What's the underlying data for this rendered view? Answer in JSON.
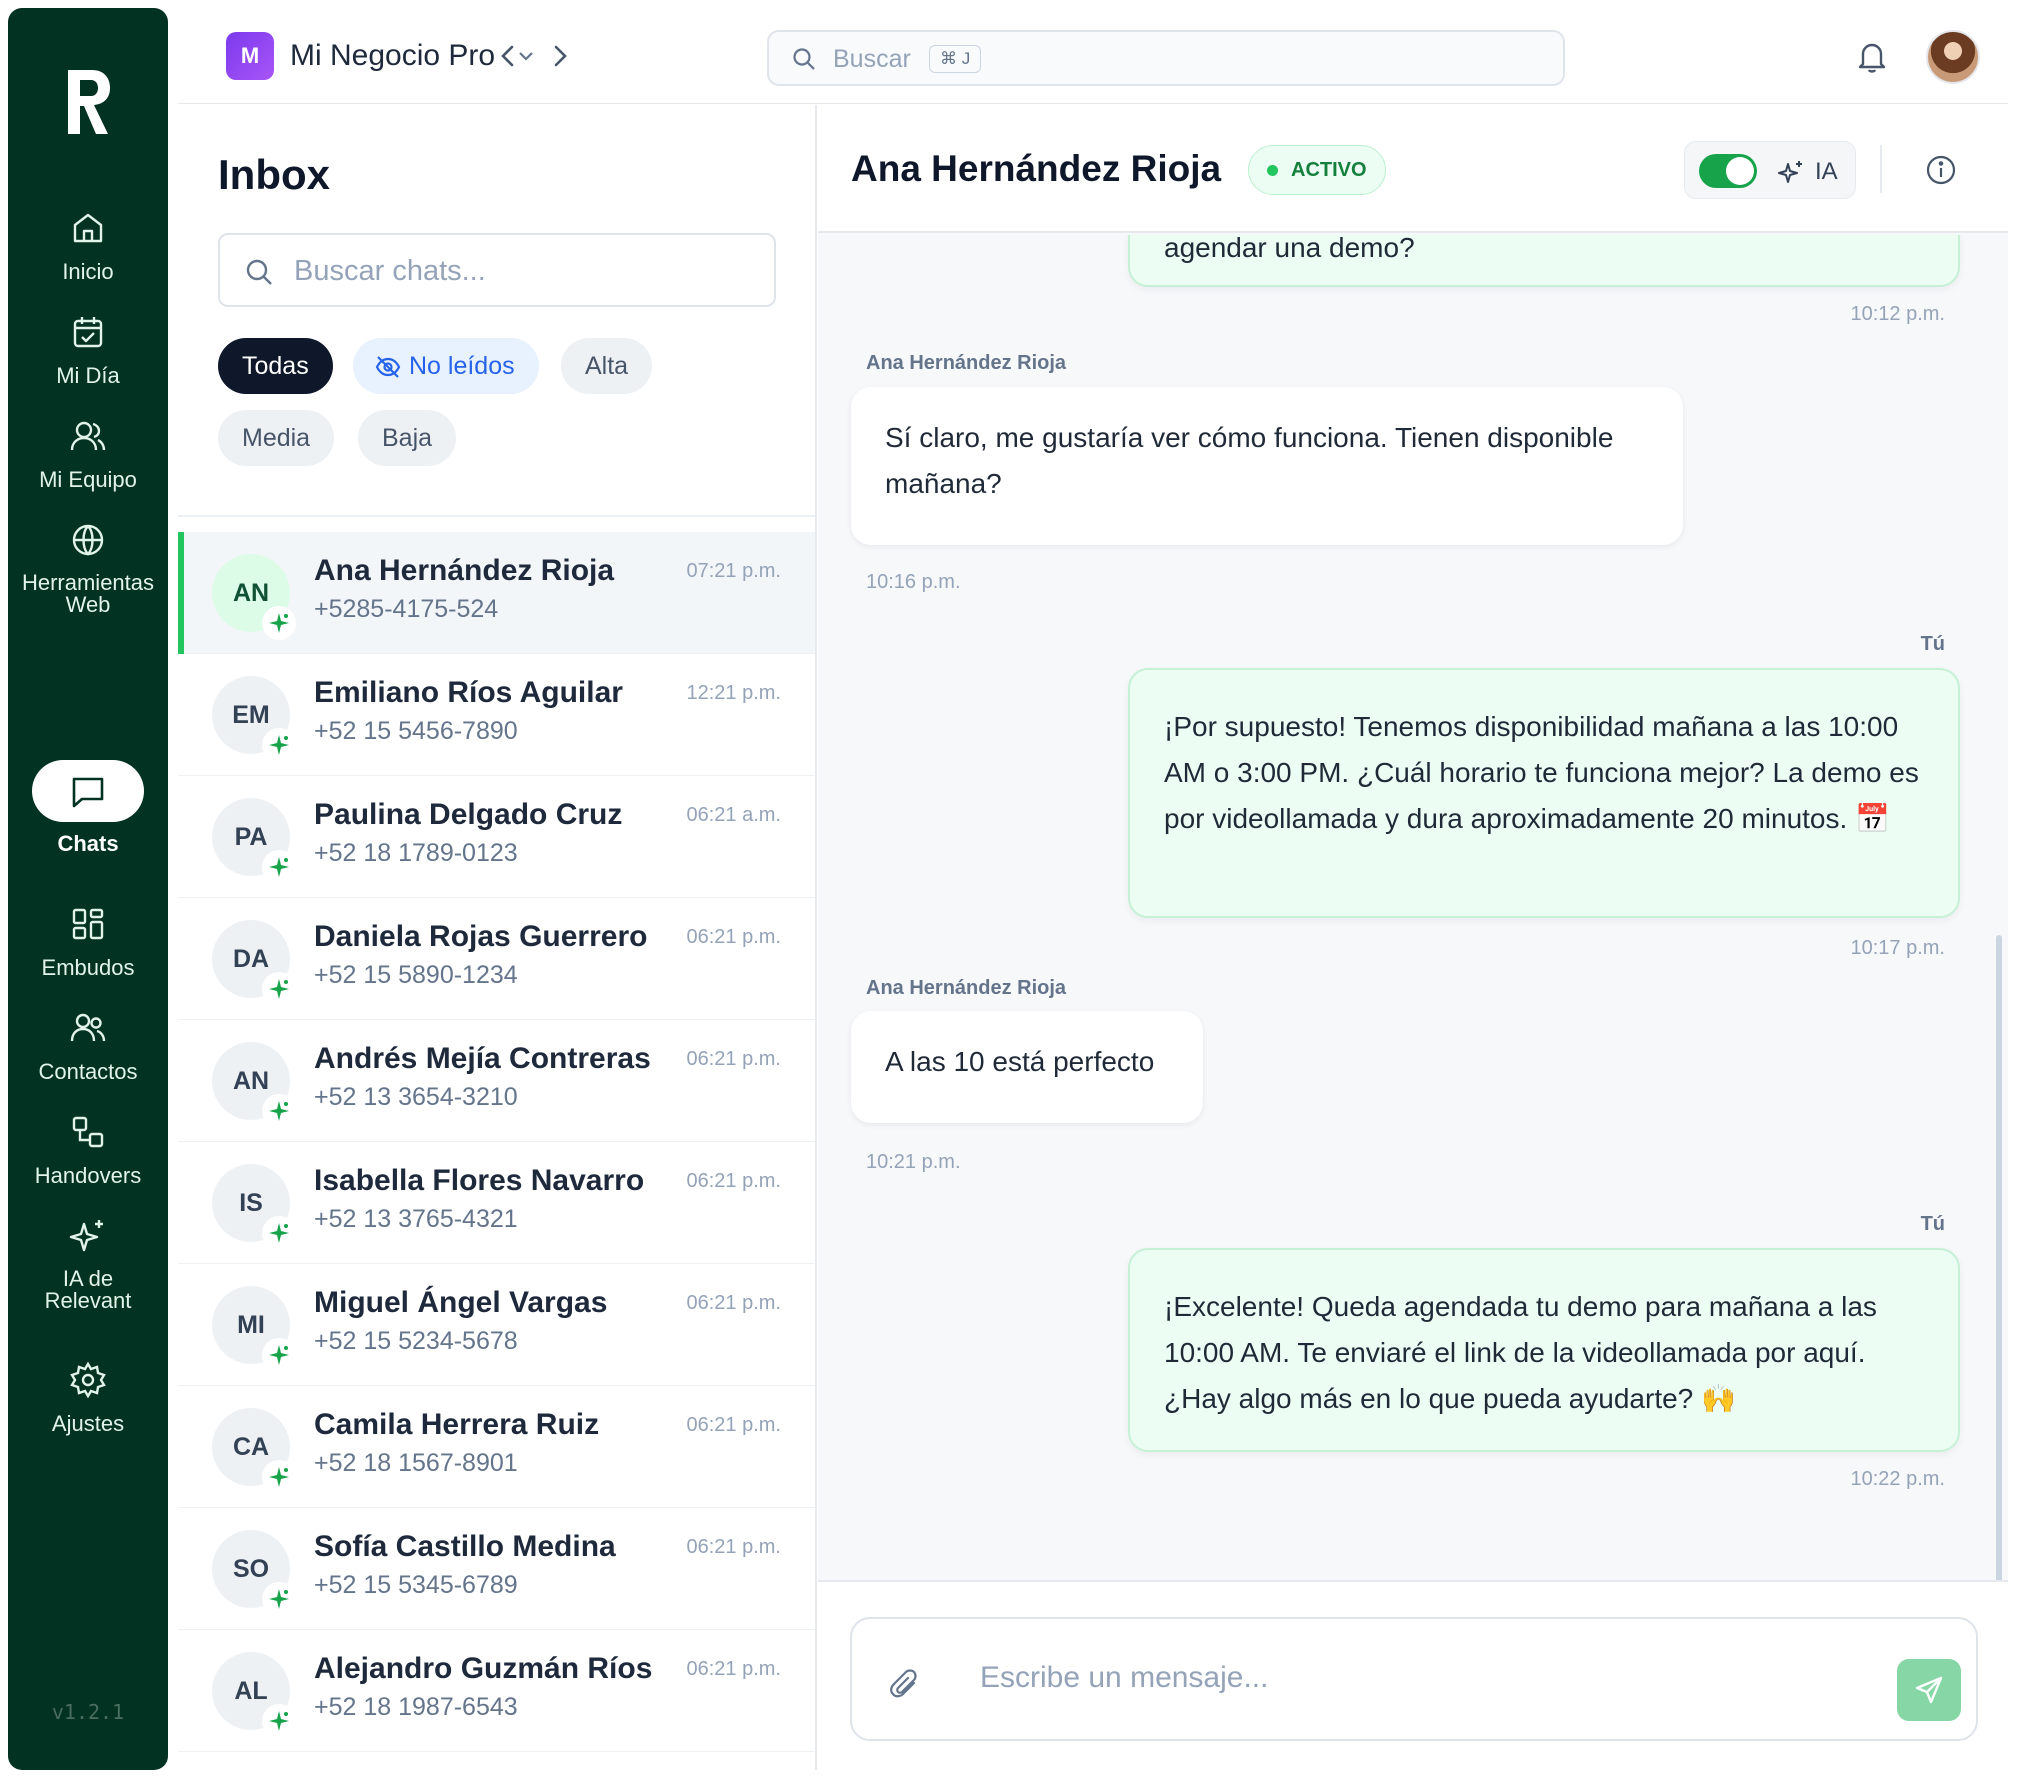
{
  "sidebar": {
    "items": [
      {
        "label": "Inicio",
        "icon": "home-icon"
      },
      {
        "label": "Mi Día",
        "icon": "calendar-check-icon"
      },
      {
        "label": "Mi Equipo",
        "icon": "users-icon"
      },
      {
        "label": "Herramientas Web",
        "icon": "globe-icon"
      },
      {
        "label": "Chats",
        "icon": "chat-icon",
        "active": true
      },
      {
        "label": "Embudos",
        "icon": "grid-icon"
      },
      {
        "label": "Contactos",
        "icon": "contacts-icon"
      },
      {
        "label": "Handovers",
        "icon": "handover-icon"
      },
      {
        "label": "IA de Relevant",
        "icon": "sparkles-icon"
      },
      {
        "label": "Ajustes",
        "icon": "gear-icon"
      }
    ],
    "version": "v1.2.1"
  },
  "topbar": {
    "workspace_initial": "M",
    "workspace_name": "Mi Negocio Pro",
    "search_placeholder": "Buscar",
    "search_shortcut": "⌘ J"
  },
  "inbox": {
    "title": "Inbox",
    "search_placeholder": "Buscar chats...",
    "filters": [
      "Todas",
      "No leídos",
      "Alta",
      "Media",
      "Baja"
    ],
    "chats": [
      {
        "initials": "AN",
        "name": "Ana Hernández Rioja",
        "phone": "+5285-4175-524",
        "time": "07:21 p.m.",
        "active": true
      },
      {
        "initials": "EM",
        "name": "Emiliano Ríos Aguilar",
        "phone": "+52 15 5456-7890",
        "time": "12:21 p.m."
      },
      {
        "initials": "PA",
        "name": "Paulina Delgado Cruz",
        "phone": "+52 18 1789-0123",
        "time": "06:21 a.m."
      },
      {
        "initials": "DA",
        "name": "Daniela Rojas Guerrero",
        "phone": "+52 15 5890-1234",
        "time": "06:21 p.m."
      },
      {
        "initials": "AN",
        "name": "Andrés Mejía Contreras",
        "phone": "+52 13 3654-3210",
        "time": "06:21 p.m."
      },
      {
        "initials": "IS",
        "name": "Isabella Flores Navarro",
        "phone": "+52 13 3765-4321",
        "time": "06:21 p.m."
      },
      {
        "initials": "MI",
        "name": "Miguel Ángel Vargas",
        "phone": "+52 15 5234-5678",
        "time": "06:21 p.m."
      },
      {
        "initials": "CA",
        "name": "Camila Herrera Ruiz",
        "phone": "+52 18 1567-8901",
        "time": "06:21 p.m."
      },
      {
        "initials": "SO",
        "name": "Sofía Castillo Medina",
        "phone": "+52 15 5345-6789",
        "time": "06:21 p.m."
      },
      {
        "initials": "AL",
        "name": "Alejandro Guzmán Ríos",
        "phone": "+52 18 1987-6543",
        "time": "06:21 p.m."
      }
    ]
  },
  "conversation": {
    "contact_name": "Ana Hernández Rioja",
    "status": "ACTIVO",
    "ai_label": "IA",
    "ai_enabled": true,
    "messages": [
      {
        "direction": "out",
        "text": "agendar una demo?",
        "time": "10:12 p.m."
      },
      {
        "direction": "in",
        "sender": "Ana Hernández Rioja",
        "text": "Sí claro, me gustaría ver cómo funciona. Tienen disponible mañana?",
        "time": "10:16 p.m."
      },
      {
        "direction": "out",
        "sender": "Tú",
        "text": "¡Por supuesto! Tenemos disponibilidad mañana a las 10:00 AM o 3:00 PM. ¿Cuál horario te funciona mejor? La demo es por videollamada y dura aproximadamente 20 minutos. 📅",
        "time": "10:17 p.m."
      },
      {
        "direction": "in",
        "sender": "Ana Hernández Rioja",
        "text": "A las 10 está perfecto",
        "time": "10:21 p.m."
      },
      {
        "direction": "out",
        "sender": "Tú",
        "text": "¡Excelente! Queda agendada tu demo para mañana a las 10:00 AM. Te enviaré el link de la videollamada por aquí. ¿Hay algo más en lo que pueda ayudarte? 🙌",
        "time": "10:22 p.m."
      }
    ],
    "composer_placeholder": "Escribe un mensaje..."
  },
  "colors": {
    "sidebar_bg": "#023222",
    "accent_green": "#22c55e",
    "outgoing_bubble": "#ecfdf3",
    "filter_active": "#0f172a",
    "unread_chip": "#2563eb"
  }
}
